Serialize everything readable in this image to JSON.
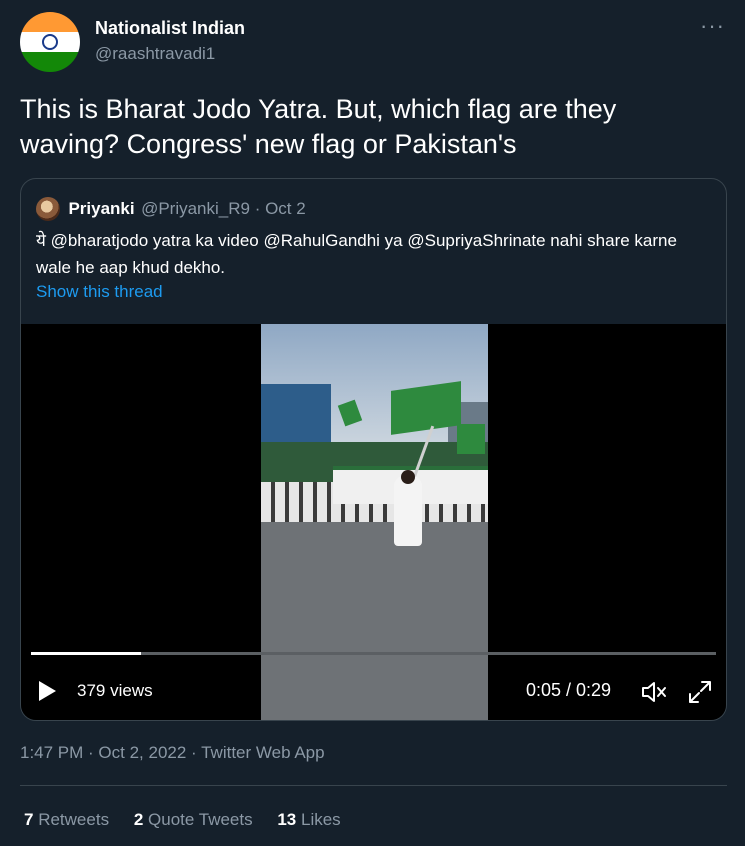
{
  "author": {
    "display_name": "Nationalist Indian",
    "handle": "@raashtravadi1",
    "avatar_icon": "india-flag-avatar",
    "flag_colors": [
      "#ff9933",
      "#ffffff",
      "#138808"
    ]
  },
  "tweet": {
    "text": "This is Bharat Jodo Yatra. But, which flag are they waving? Congress' new flag or Pakistan's",
    "timestamp": "1:47 PM · Oct 2, 2022 · Twitter Web App"
  },
  "quoted": {
    "name": "Priyanki",
    "meta": "@Priyanki_R9 · Oct 2",
    "text": "ये @bharatjodo yatra ka video @RahulGandhi ya @SupriyaShrinate nahi share karne wale he aap khud dekho.",
    "show_thread": "Show this thread",
    "video": {
      "views": "379 views",
      "time": "0:05 / 0:29",
      "progress": 0.16
    }
  },
  "stats": {
    "retweets_count": "7",
    "retweets_label": "Retweets",
    "quotes_count": "2",
    "quotes_label": "Quote Tweets",
    "likes_count": "13",
    "likes_label": "Likes"
  },
  "colors": {
    "background": "#15202b",
    "link": "#1d9bf0",
    "muted": "#8b98a5"
  }
}
